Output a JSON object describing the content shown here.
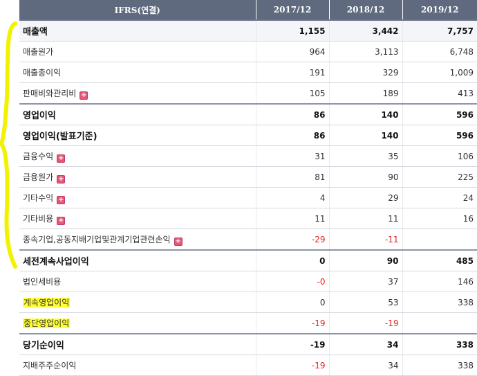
{
  "header": {
    "label_col": "IFRS(연결)",
    "periods": [
      "2017/12",
      "2018/12",
      "2019/12"
    ]
  },
  "rows": [
    {
      "label": "매출액",
      "values": [
        "1,155",
        "3,442",
        "7,757"
      ]
    },
    {
      "label": "매출원가",
      "values": [
        "964",
        "3,113",
        "6,748"
      ]
    },
    {
      "label": "매출총이익",
      "values": [
        "191",
        "329",
        "1,009"
      ]
    },
    {
      "label": "판매비와관리비",
      "values": [
        "105",
        "189",
        "413"
      ]
    },
    {
      "label": "영업이익",
      "values": [
        "86",
        "140",
        "596"
      ]
    },
    {
      "label": "영업이익(발표기준)",
      "values": [
        "86",
        "140",
        "596"
      ]
    },
    {
      "label": "금융수익",
      "values": [
        "31",
        "35",
        "106"
      ]
    },
    {
      "label": "금융원가",
      "values": [
        "81",
        "90",
        "225"
      ]
    },
    {
      "label": "기타수익",
      "values": [
        "4",
        "29",
        "24"
      ]
    },
    {
      "label": "기타비용",
      "values": [
        "11",
        "11",
        "16"
      ]
    },
    {
      "label": "종속기업,공동지배기업및관계기업관련손익",
      "values": [
        "-29",
        "-11",
        ""
      ]
    },
    {
      "label": "세전계속사업이익",
      "values": [
        "0",
        "90",
        "485"
      ]
    },
    {
      "label": "법인세비용",
      "values": [
        "-0",
        "37",
        "146"
      ]
    },
    {
      "label": "계속영업이익",
      "values": [
        "0",
        "53",
        "338"
      ]
    },
    {
      "label": "중단영업이익",
      "values": [
        "-19",
        "-19",
        ""
      ]
    },
    {
      "label": "당기순이익",
      "values": [
        "-19",
        "34",
        "338"
      ]
    },
    {
      "label": "지배주주순이익",
      "values": [
        "-19",
        "34",
        "338"
      ]
    }
  ],
  "expand_icon": "plus-icon",
  "colors": {
    "header_bg": "#5f6a7f",
    "negative": "#e02020",
    "highlight": "#ffff33",
    "brace": "#f2f200"
  }
}
